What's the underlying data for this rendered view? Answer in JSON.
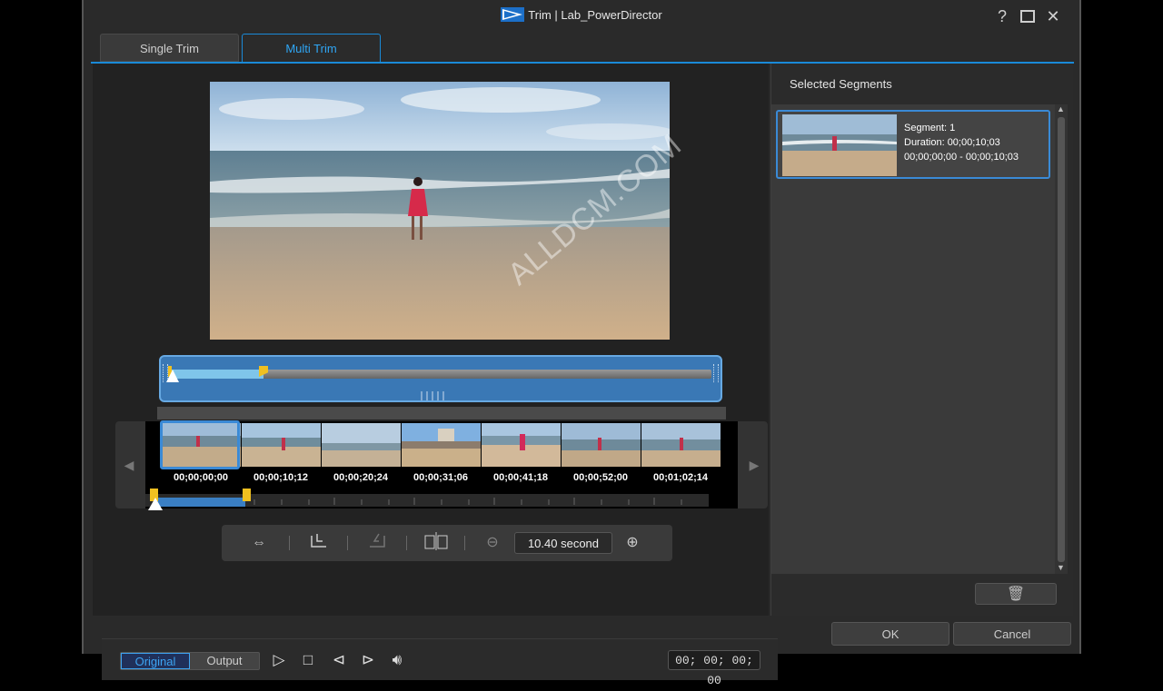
{
  "window": {
    "title": "Trim | Lab_PowerDirector",
    "help_icon": "question-icon",
    "maximize_icon": "maximize-icon",
    "close_icon": "close-icon"
  },
  "tabs": [
    {
      "label": "Single Trim",
      "active": false
    },
    {
      "label": "Multi Trim",
      "active": true
    }
  ],
  "watermark": "ALLDCM.COM",
  "thumbnails": [
    {
      "time": "00;00;00;00"
    },
    {
      "time": "00;00;10;12"
    },
    {
      "time": "00;00;20;24"
    },
    {
      "time": "00;00;31;06"
    },
    {
      "time": "00;00;41;18"
    },
    {
      "time": "00;00;52;00"
    },
    {
      "time": "00;01;02;14"
    }
  ],
  "zoom": {
    "value": "10.40 second"
  },
  "playback": {
    "original_label": "Original",
    "output_label": "Output",
    "timecode": "00; 00; 00; 00"
  },
  "segments_panel": {
    "title": "Selected Segments",
    "items": [
      {
        "segment": "Segment: 1",
        "duration": "Duration: 00;00;10;03",
        "range": "00;00;00;00 - 00;00;10;03"
      }
    ]
  },
  "buttons": {
    "ok": "OK",
    "cancel": "Cancel"
  },
  "colors": {
    "accent": "#1a8ad8",
    "marker": "#f0c020"
  }
}
